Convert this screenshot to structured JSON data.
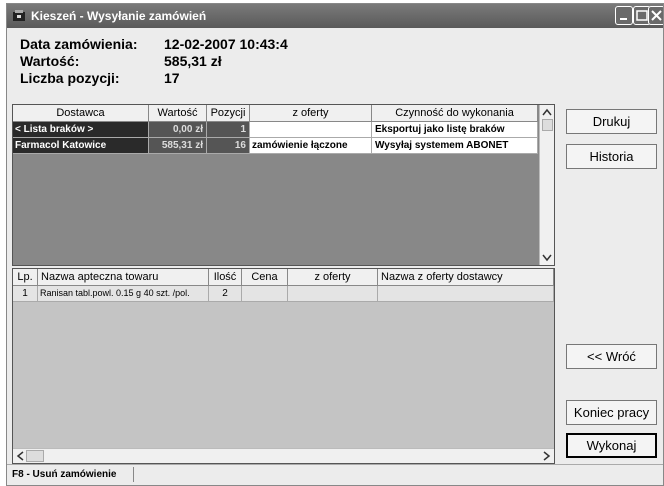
{
  "window": {
    "title": "Kieszeń - Wysyłanie zamówień"
  },
  "header": {
    "date_label": "Data zamówienia:",
    "date_value": "12-02-2007 10:43:4",
    "value_label": "Wartość:",
    "value_value": "585,31 zł",
    "count_label": "Liczba pozycji:",
    "count_value": "17"
  },
  "orders": {
    "columns": [
      "Dostawca",
      "Wartość",
      "Pozycji",
      "z oferty",
      "Czynność do wykonania"
    ],
    "rows": [
      {
        "supplier": "< Lista braków >",
        "value": "0,00 zł",
        "items": "1",
        "offer": "",
        "action": "Eksportuj jako listę braków"
      },
      {
        "supplier": "Farmacol Katowice",
        "value": "585,31 zł",
        "items": "16",
        "offer": "zamówienie łączone",
        "action": "Wysyłaj systemem ABONET"
      }
    ]
  },
  "items": {
    "columns": [
      "Lp.",
      "Nazwa apteczna towaru",
      "Ilość",
      "Cena",
      "z oferty",
      "Nazwa z oferty dostawcy"
    ],
    "rows": [
      {
        "lp": "1",
        "name": "Ranisan tabl.powl. 0.15 g 40 szt.  /pol.",
        "qty": "2",
        "price": "",
        "offer": "",
        "offer_name": ""
      }
    ]
  },
  "buttons": {
    "print": "Drukuj",
    "history": "Historia",
    "back": "<< Wróć",
    "end": "Koniec pracy",
    "execute": "Wykonaj"
  },
  "statusbar": {
    "hint": "F8 - Usuń zamówienie"
  },
  "colors": {
    "titlebar": "#6a6a6a",
    "selected_row": "#2a2a2a",
    "grid_bg": "#888888"
  }
}
